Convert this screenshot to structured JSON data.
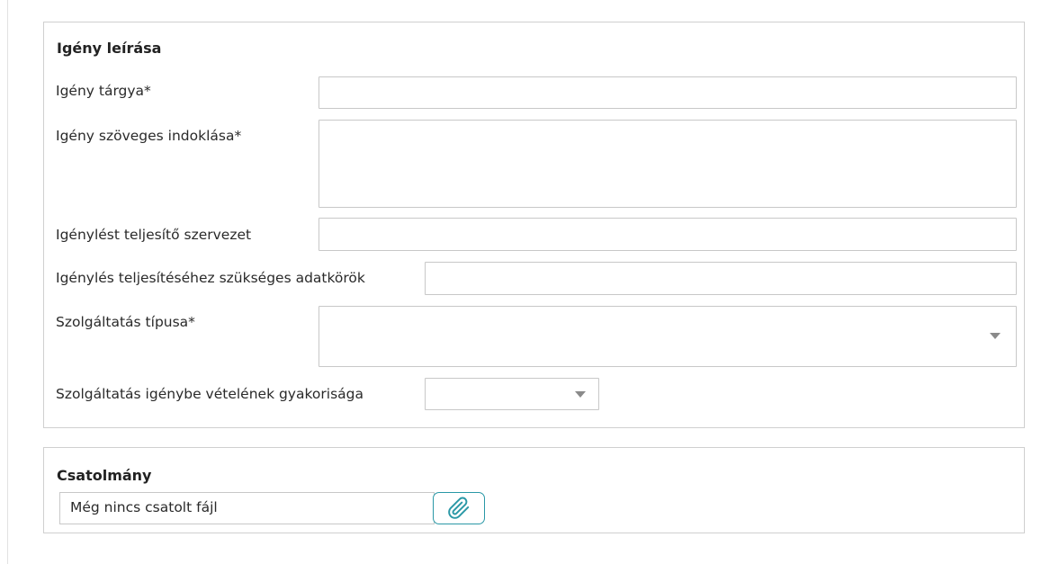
{
  "description_panel": {
    "title": "Igény leírása",
    "fields": {
      "subject": {
        "label": "Igény tárgya*",
        "value": ""
      },
      "justification": {
        "label": "Igény szöveges indoklása*",
        "value": ""
      },
      "fulfilling_org": {
        "label": "Igénylést teljesítő szervezet",
        "value": ""
      },
      "data_scopes": {
        "label": "Igénylés teljesítéséhez szükséges adatkörök",
        "value": ""
      },
      "service_type": {
        "label": "Szolgáltatás típusa*",
        "selected": ""
      },
      "usage_frequency": {
        "label": "Szolgáltatás igénybe vételének gyakorisága",
        "selected": ""
      }
    }
  },
  "attachment_panel": {
    "title": "Csatolmány",
    "file_status": "Még nincs csatolt fájl",
    "attach_icon": "paperclip-icon"
  },
  "colors": {
    "border": "#cfcfcf",
    "field_border": "#c8c8c8",
    "accent": "#2a98a6",
    "caret": "#8a8a8a"
  }
}
